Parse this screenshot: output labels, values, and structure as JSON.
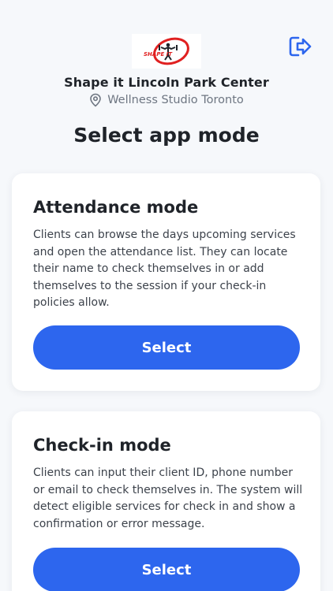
{
  "header": {
    "logo_text": "SHAPE IT",
    "studio_name": "Shape it Lincoln Park Center",
    "location": "Wellness Studio Toronto"
  },
  "page_title": "Select app mode",
  "modes": [
    {
      "title": "Attendance mode",
      "description": "Clients can browse the days upcoming services and open the attendance list. They can locate their name to check themselves in or add themselves to the session if your check-in policies allow.",
      "button_label": "Select"
    },
    {
      "title": "Check-in mode",
      "description": "Clients can input their client ID, phone number or email to check themselves in. The system will detect eligible services for check in and show a confirmation or error message.",
      "button_label": "Select"
    }
  ],
  "colors": {
    "accent": "#2D66EE",
    "background": "#F6F8FB",
    "logo_red": "#E02020"
  },
  "icons": {
    "logout": "logout-icon",
    "location": "location-pin-icon"
  }
}
